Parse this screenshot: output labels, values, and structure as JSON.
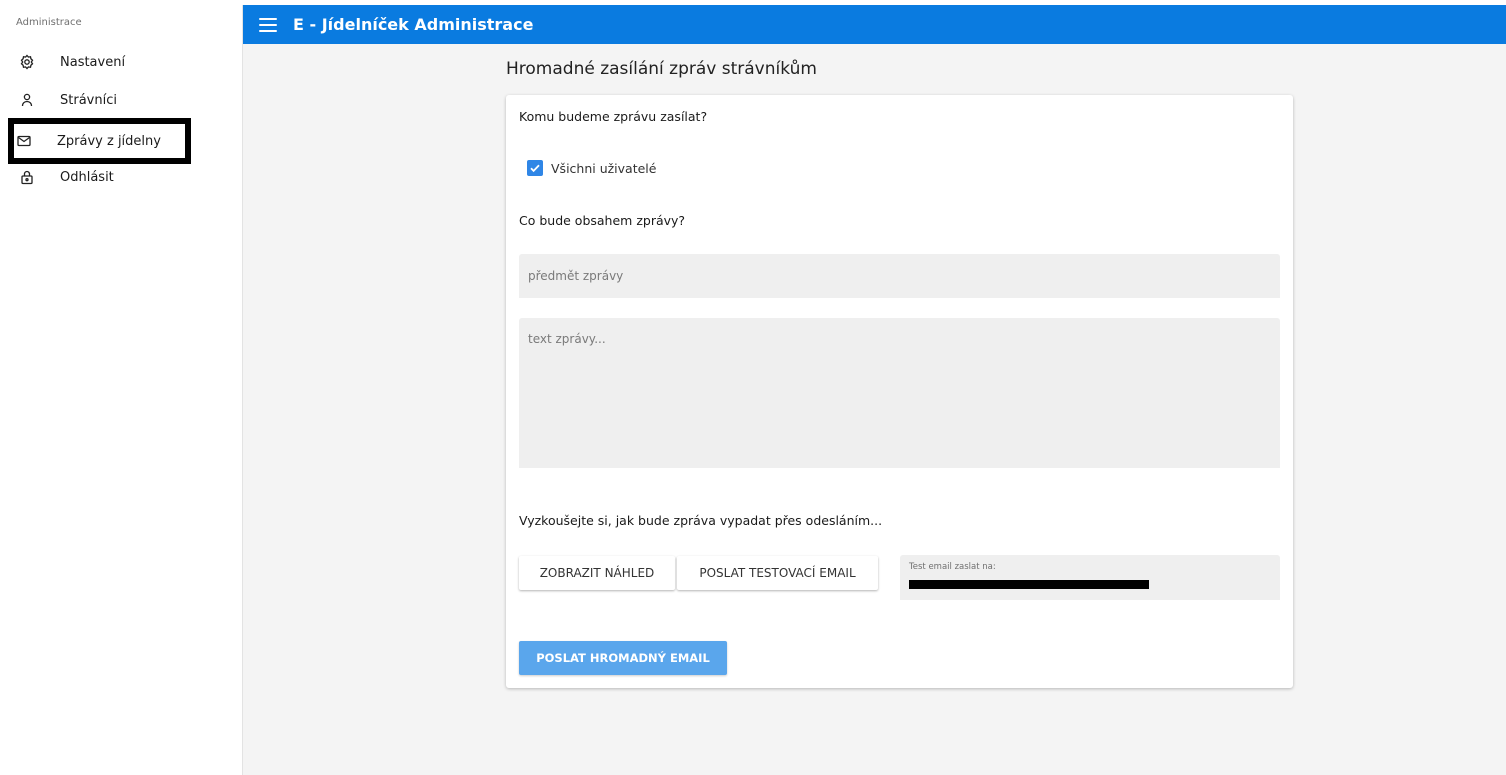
{
  "sidebar": {
    "title": "Administrace",
    "items": [
      {
        "label": "Nastavení",
        "icon": "gear-icon"
      },
      {
        "label": "Strávníci",
        "icon": "user-icon"
      },
      {
        "label": "Zprávy z jídelny",
        "icon": "envelope-icon",
        "selected": true
      },
      {
        "label": "Odhlásit",
        "icon": "lock-icon"
      }
    ]
  },
  "topbar": {
    "title": "E - Jídelníček Administrace",
    "color": "#0a7be0"
  },
  "main": {
    "page_title": "Hromadné zasílání zpráv strávníkům",
    "recipients_question": "Komu budeme zprávu zasílat?",
    "all_users_label": "Všichni uživatelé",
    "all_users_checked": true,
    "content_question": "Co bude obsahem zprávy?",
    "subject_placeholder": "předmět zprávy",
    "subject_value": "",
    "text_placeholder": "text zprávy...",
    "text_value": "",
    "preview_hint": "Vyzkoušejte si, jak bude zpráva vypadat přes odesláním...",
    "preview_button": "ZOBRAZIT NÁHLED",
    "test_email_button": "POSLAT TESTOVACÍ EMAIL",
    "test_email_label": "Test email zaslat na:",
    "send_button": "POSLAT HROMADNÝ EMAIL"
  },
  "colors": {
    "accent": "#0a7be0",
    "checkbox": "#2f86e6",
    "send_button": "#5aa6ec"
  }
}
